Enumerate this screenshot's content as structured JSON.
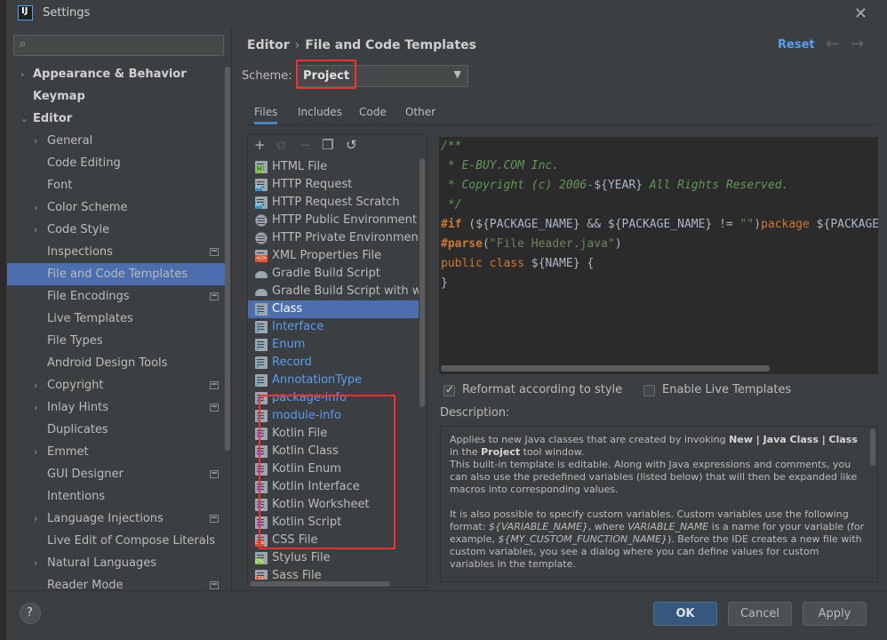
{
  "window": {
    "title": "Settings",
    "app_icon_text": "IJ"
  },
  "search": {
    "placeholder": ""
  },
  "sidebar": {
    "items": [
      {
        "label": "Appearance & Behavior",
        "bold": true,
        "arrow": "›",
        "indent": 0
      },
      {
        "label": "Keymap",
        "bold": true,
        "arrow": "",
        "indent": 0
      },
      {
        "label": "Editor",
        "bold": true,
        "arrow": "⌄",
        "indent": 0
      },
      {
        "label": "General",
        "arrow": "›",
        "indent": 1
      },
      {
        "label": "Code Editing",
        "arrow": "",
        "indent": 1
      },
      {
        "label": "Font",
        "arrow": "",
        "indent": 1
      },
      {
        "label": "Color Scheme",
        "arrow": "›",
        "indent": 1
      },
      {
        "label": "Code Style",
        "arrow": "›",
        "indent": 1
      },
      {
        "label": "Inspections",
        "arrow": "",
        "indent": 1,
        "project": true
      },
      {
        "label": "File and Code Templates",
        "arrow": "",
        "indent": 1,
        "selected": true
      },
      {
        "label": "File Encodings",
        "arrow": "",
        "indent": 1,
        "project": true
      },
      {
        "label": "Live Templates",
        "arrow": "",
        "indent": 1
      },
      {
        "label": "File Types",
        "arrow": "",
        "indent": 1
      },
      {
        "label": "Android Design Tools",
        "arrow": "",
        "indent": 1
      },
      {
        "label": "Copyright",
        "arrow": "›",
        "indent": 1,
        "project": true
      },
      {
        "label": "Inlay Hints",
        "arrow": "›",
        "indent": 1,
        "project": true
      },
      {
        "label": "Duplicates",
        "arrow": "",
        "indent": 1
      },
      {
        "label": "Emmet",
        "arrow": "›",
        "indent": 1
      },
      {
        "label": "GUI Designer",
        "arrow": "",
        "indent": 1,
        "project": true
      },
      {
        "label": "Intentions",
        "arrow": "",
        "indent": 1
      },
      {
        "label": "Language Injections",
        "arrow": "›",
        "indent": 1,
        "project": true
      },
      {
        "label": "Live Edit of Compose Literals",
        "arrow": "",
        "indent": 1
      },
      {
        "label": "Natural Languages",
        "arrow": "›",
        "indent": 1
      },
      {
        "label": "Reader Mode",
        "arrow": "",
        "indent": 1,
        "project": true
      }
    ]
  },
  "header": {
    "breadcrumb": [
      "Editor",
      "File and Code Templates"
    ],
    "breadcrumb_sep": "›",
    "reset_label": "Reset",
    "back_icon": "←",
    "forward_icon": "→"
  },
  "scheme": {
    "label": "Scheme:",
    "value": "Project"
  },
  "tabs": [
    "Files",
    "Includes",
    "Code",
    "Other"
  ],
  "toolbar": {
    "add": "+",
    "copy_disabled": "⧉",
    "remove": "−",
    "duplicate": "❐",
    "revert": "↺"
  },
  "templates": [
    {
      "name": "HTML File",
      "icon": "ic-h"
    },
    {
      "name": "HTTP Request",
      "icon": "ic-api"
    },
    {
      "name": "HTTP Request Scratch",
      "icon": "ic-api"
    },
    {
      "name": "HTTP Public Environment File",
      "icon": "ic-globe"
    },
    {
      "name": "HTTP Private Environment File",
      "icon": "ic-globe"
    },
    {
      "name": "XML Properties File",
      "icon": "ic-xml"
    },
    {
      "name": "Gradle Build Script",
      "icon": "ic-gradle"
    },
    {
      "name": "Gradle Build Script with wrapper",
      "icon": "ic-gradle"
    },
    {
      "name": "Class",
      "icon": "ic-java",
      "selected": true
    },
    {
      "name": "Interface",
      "icon": "ic-java",
      "java": true
    },
    {
      "name": "Enum",
      "icon": "ic-java",
      "java": true
    },
    {
      "name": "Record",
      "icon": "ic-java",
      "java": true
    },
    {
      "name": "AnnotationType",
      "icon": "ic-java",
      "java": true
    },
    {
      "name": "package-info",
      "icon": "ic-java",
      "java": true
    },
    {
      "name": "module-info",
      "icon": "ic-java",
      "java": true
    },
    {
      "name": "Kotlin File",
      "icon": "ic-kt"
    },
    {
      "name": "Kotlin Class",
      "icon": "ic-kt"
    },
    {
      "name": "Kotlin Enum",
      "icon": "ic-kt"
    },
    {
      "name": "Kotlin Interface",
      "icon": "ic-kt"
    },
    {
      "name": "Kotlin Worksheet",
      "icon": "ic-kt"
    },
    {
      "name": "Kotlin Script",
      "icon": "ic-kt"
    },
    {
      "name": "CSS File",
      "icon": "ic-css"
    },
    {
      "name": "Stylus File",
      "icon": "ic-styl"
    },
    {
      "name": "Sass File",
      "icon": "ic-css"
    }
  ],
  "code": {
    "line1": "/**",
    "line2": " * E-BUY.COM Inc.",
    "line3a": " * Copyright (c) 2006-",
    "line3b": "${YEAR}",
    "line3c": " All Rights Reserved.",
    "line4": " */",
    "line5a": "#if",
    "line5b": " (${PACKAGE_NAME} && ${PACKAGE_NAME} != ",
    "line5c": "\"\"",
    "line5d": ")",
    "line5e": "package",
    "line5f": " ${PACKAGE_NAME};",
    "line6a": "#parse",
    "line6b": "(",
    "line6c": "\"File Header.java\"",
    "line6d": ")",
    "line7a": "public class",
    "line7b": " ${NAME} {",
    "line8": "}"
  },
  "options": {
    "reformat_label": "Reformat according to style",
    "reformat_checked": true,
    "live_label": "Enable Live Templates",
    "live_checked": false
  },
  "description": {
    "label": "Description:",
    "p1a": "Applies to new Java classes that are created by invoking ",
    "p1b": "New | Java Class | Class",
    "p1c": " in the ",
    "p1d": "Project",
    "p1e": " tool window.",
    "p2": "This built-in template is editable. Along with Java expressions and comments, you can also use the predefined variables (listed below) that will then be expanded like macros into corresponding values.",
    "p3a": "It is also possible to specify custom variables. Custom variables use the following format: ",
    "p3b": "${VARIABLE_NAME}",
    "p3c": ", where ",
    "p3d": "VARIABLE_NAME",
    "p3e": " is a name for your variable (for example, ",
    "p3f": "${MY_CUSTOM_FUNCTION_NAME}",
    "p3g": "). Before the IDE creates a new file with custom variables, you see a dialog where you can define values for custom variables in the template."
  },
  "footer": {
    "help": "?",
    "ok": "OK",
    "cancel": "Cancel",
    "apply": "Apply"
  },
  "colors": {
    "accent": "#589df6",
    "selection": "#4b6eaf",
    "highlight_box": "#ff2d2d",
    "ok_button": "#365880"
  }
}
